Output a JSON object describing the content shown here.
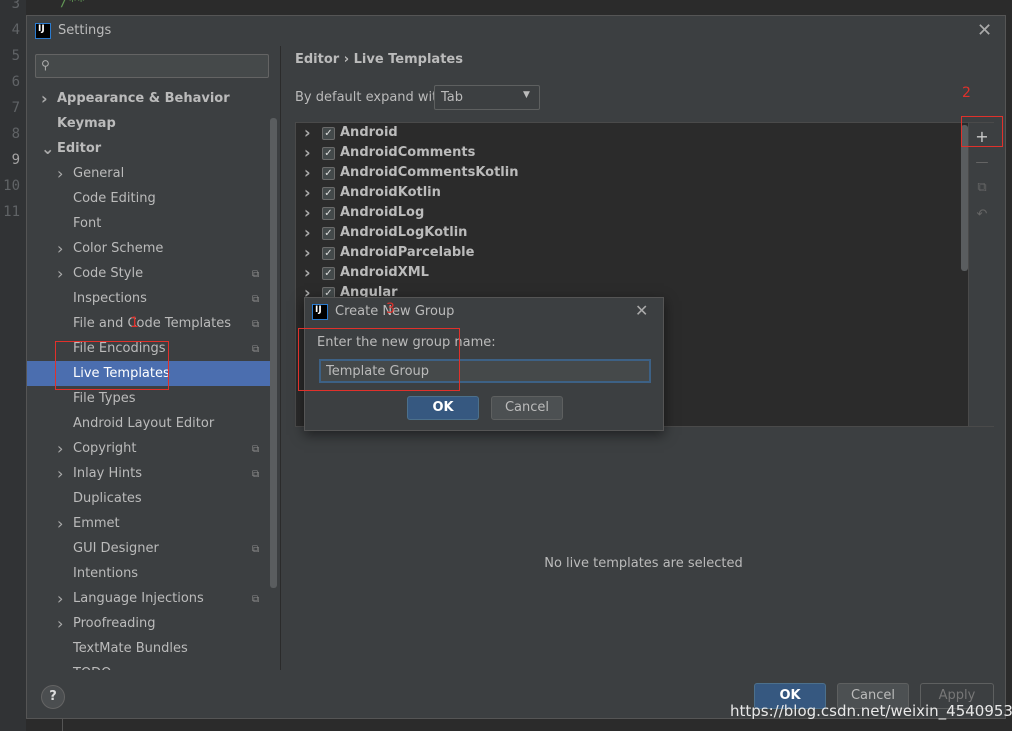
{
  "editor": {
    "line_numbers": [
      "3",
      "4",
      "5",
      "6",
      "7",
      "8",
      "9",
      "10",
      "11"
    ],
    "code_fragment": "/**"
  },
  "settings": {
    "title": "Settings",
    "search_placeholder": "",
    "sidebar": [
      {
        "label": "Appearance & Behavior",
        "level": 0,
        "chevron": ">",
        "bold": true,
        "proj": false,
        "selected": false
      },
      {
        "label": "Keymap",
        "level": 0,
        "chevron": "",
        "bold": true,
        "proj": false,
        "selected": false
      },
      {
        "label": "Editor",
        "level": 0,
        "chevron": "v",
        "bold": true,
        "proj": false,
        "selected": false
      },
      {
        "label": "General",
        "level": 1,
        "chevron": ">",
        "bold": false,
        "proj": false,
        "selected": false
      },
      {
        "label": "Code Editing",
        "level": 1,
        "chevron": "",
        "bold": false,
        "proj": false,
        "selected": false
      },
      {
        "label": "Font",
        "level": 1,
        "chevron": "",
        "bold": false,
        "proj": false,
        "selected": false
      },
      {
        "label": "Color Scheme",
        "level": 1,
        "chevron": ">",
        "bold": false,
        "proj": false,
        "selected": false
      },
      {
        "label": "Code Style",
        "level": 1,
        "chevron": ">",
        "bold": false,
        "proj": true,
        "selected": false
      },
      {
        "label": "Inspections",
        "level": 1,
        "chevron": "",
        "bold": false,
        "proj": true,
        "selected": false
      },
      {
        "label": "File and Code Templates",
        "level": 1,
        "chevron": "",
        "bold": false,
        "proj": true,
        "selected": false
      },
      {
        "label": "File Encodings",
        "level": 1,
        "chevron": "",
        "bold": false,
        "proj": true,
        "selected": false
      },
      {
        "label": "Live Templates",
        "level": 1,
        "chevron": "",
        "bold": false,
        "proj": false,
        "selected": true
      },
      {
        "label": "File Types",
        "level": 1,
        "chevron": "",
        "bold": false,
        "proj": false,
        "selected": false
      },
      {
        "label": "Android Layout Editor",
        "level": 1,
        "chevron": "",
        "bold": false,
        "proj": false,
        "selected": false
      },
      {
        "label": "Copyright",
        "level": 1,
        "chevron": ">",
        "bold": false,
        "proj": true,
        "selected": false
      },
      {
        "label": "Inlay Hints",
        "level": 1,
        "chevron": ">",
        "bold": false,
        "proj": true,
        "selected": false
      },
      {
        "label": "Duplicates",
        "level": 1,
        "chevron": "",
        "bold": false,
        "proj": false,
        "selected": false
      },
      {
        "label": "Emmet",
        "level": 1,
        "chevron": ">",
        "bold": false,
        "proj": false,
        "selected": false
      },
      {
        "label": "GUI Designer",
        "level": 1,
        "chevron": "",
        "bold": false,
        "proj": true,
        "selected": false
      },
      {
        "label": "Intentions",
        "level": 1,
        "chevron": "",
        "bold": false,
        "proj": false,
        "selected": false
      },
      {
        "label": "Language Injections",
        "level": 1,
        "chevron": ">",
        "bold": false,
        "proj": true,
        "selected": false
      },
      {
        "label": "Proofreading",
        "level": 1,
        "chevron": ">",
        "bold": false,
        "proj": false,
        "selected": false
      },
      {
        "label": "TextMate Bundles",
        "level": 1,
        "chevron": "",
        "bold": false,
        "proj": false,
        "selected": false
      },
      {
        "label": "TODO",
        "level": 1,
        "chevron": "",
        "bold": false,
        "proj": false,
        "selected": false
      }
    ],
    "breadcrumb": "Editor  ›  Live Templates",
    "expand_label": "By default expand with",
    "expand_value": "Tab",
    "template_groups": [
      {
        "name": "Android",
        "checked": true
      },
      {
        "name": "AndroidComments",
        "checked": true
      },
      {
        "name": "AndroidCommentsKotlin",
        "checked": true
      },
      {
        "name": "AndroidKotlin",
        "checked": true
      },
      {
        "name": "AndroidLog",
        "checked": true
      },
      {
        "name": "AndroidLogKotlin",
        "checked": true
      },
      {
        "name": "AndroidParcelable",
        "checked": true
      },
      {
        "name": "AndroidXML",
        "checked": true
      },
      {
        "name": "Angular",
        "checked": true
      }
    ],
    "empty_message": "No live templates are selected",
    "buttons": {
      "help": "?",
      "ok": "OK",
      "cancel": "Cancel",
      "apply": "Apply"
    }
  },
  "dialog": {
    "title": "Create New Group",
    "prompt": "Enter the new group name:",
    "input_value": "Template Group",
    "ok": "OK",
    "cancel": "Cancel"
  },
  "annotations": {
    "label_1": "1",
    "label_2": "2",
    "label_3": "3",
    "color": "#e0312b"
  },
  "watermark": "https://blog.csdn.net/weixin_45409533"
}
